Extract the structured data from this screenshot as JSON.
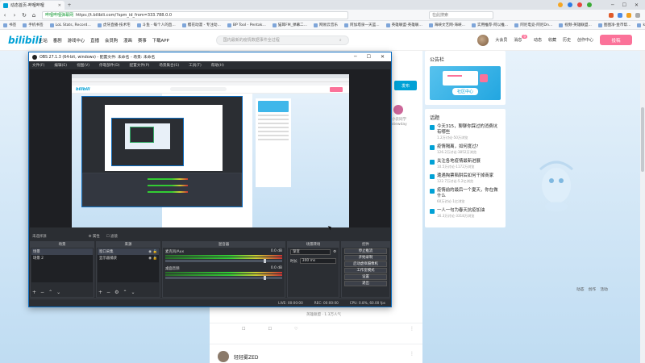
{
  "browser": {
    "tab_title": "动态首页-哔哩哔哩",
    "tray_colors": [
      "#f5a623",
      "#2c7be5",
      "#e8453c",
      "#3aaa35"
    ],
    "window_controls": [
      "─",
      "☐",
      "✕"
    ],
    "security_text": "哔哩哔哩弹幕网",
    "url": "https://t.bilibili.com/?spm_id_from=333.788.0.0",
    "search_placeholder": "在此搜索",
    "bookmarks": [
      "书签",
      "手机书签",
      "LoL Stats, Record...",
      "虎牙直播-技术宅",
      "斗鱼 - 每个人的直...",
      "樱花动漫 - 专注动...",
      "BP Tool - Pentak...",
      "猫耳FM_弹幕二...",
      "网易云音乐",
      "阿加塔泉一天篮...",
      "英雄联盟-英雄联...",
      "海峡文艺网-海峡...",
      "实用推荐-阿以推...",
      "阿尼电竞-阿尼Dn...",
      "视频-英雄联盟...",
      "图图净-金币帮...",
      "knight"
    ]
  },
  "bili": {
    "logo": "bilibili",
    "nav": [
      "主站",
      "番剧",
      "游戏中心",
      "直播",
      "会员购",
      "漫画",
      "赛事",
      "下载APP"
    ],
    "search_placeholder": "国内最新的疫情数据事件全过程",
    "right": [
      "大会员",
      "消息",
      "动态",
      "收藏",
      "历史",
      "创作中心"
    ],
    "message_badge": "9",
    "upload": "投稿"
  },
  "feed": {
    "publish": "发布",
    "side_user_label": "小云同学 stewday",
    "card_actions": [
      "☐",
      "☐",
      "♡"
    ],
    "live_meta": "英雄联盟 · 1.3万人气",
    "user_name": "轻轻雾ZED"
  },
  "sidebar": {
    "announce_title": "公告栏",
    "community_label": "社区中心",
    "topics_title": "话题",
    "topics": [
      {
        "title": "今天315，聊聊你踩过的消费坑有哪些",
        "meta": "1.2万讨论·50万浏览"
      },
      {
        "title": "疫情隔离，如何度过?",
        "meta": "126.2万讨论·3852万浏览"
      },
      {
        "title": "关注各地疫情最新进展",
        "meta": "10.5万讨论·1172万浏览"
      },
      {
        "title": "遭遇掏票陷阱后如何干掉商家",
        "meta": "122.7万讨论·5.2亿浏览"
      },
      {
        "title": "疫情前的最后一个夏天，你在做什么",
        "meta": "60万讨论·1亿浏览"
      },
      {
        "title": "一人一句为春天抗疫加油",
        "meta": "16.3万讨论·3318万浏览"
      }
    ],
    "tools": [
      "动态",
      "创作",
      "活动"
    ]
  },
  "obs": {
    "title": "OBS 27.1.3 (64-bit, windows) - 配置文件: 未命名 - 场景: 未命名",
    "menu": [
      "文件(F)",
      "编辑(E)",
      "视图(V)",
      "停靠部件(D)",
      "配置文件(P)",
      "场景集合(S)",
      "工具(T)",
      "帮助(H)"
    ],
    "source_bar_label": "未选择源",
    "source_bar_props": [
      "⚙ 属性",
      "☐ 滤镜"
    ],
    "docks": {
      "scenes_title": "场景",
      "scenes": [
        "场景",
        "场景 2"
      ],
      "sources_title": "来源",
      "sources": [
        "窗口采集",
        "显示器捕获"
      ],
      "mixer_title": "混音器",
      "mixer": [
        {
          "name": "麦克风/Aux",
          "db": "0.0 dB"
        },
        {
          "name": "桌面音频",
          "db": "0.0 dB"
        }
      ],
      "transitions_title": "场景转场",
      "transition": "渐变",
      "duration_label": "时长",
      "duration": "300 ms",
      "controls_title": "控件",
      "controls": [
        "停止推流",
        "开始录制",
        "启动虚拟摄像机",
        "工作室模式",
        "设置",
        "退出"
      ]
    },
    "status": {
      "live": "LIVE: 00:00:00",
      "rec": "REC: 00:00:00",
      "cpu": "CPU: 0.8%, 60.00 fps"
    }
  },
  "colors": {
    "bili_blue": "#00a1d6",
    "bili_pink": "#fb7299",
    "obs_bg": "#2b2e33"
  }
}
